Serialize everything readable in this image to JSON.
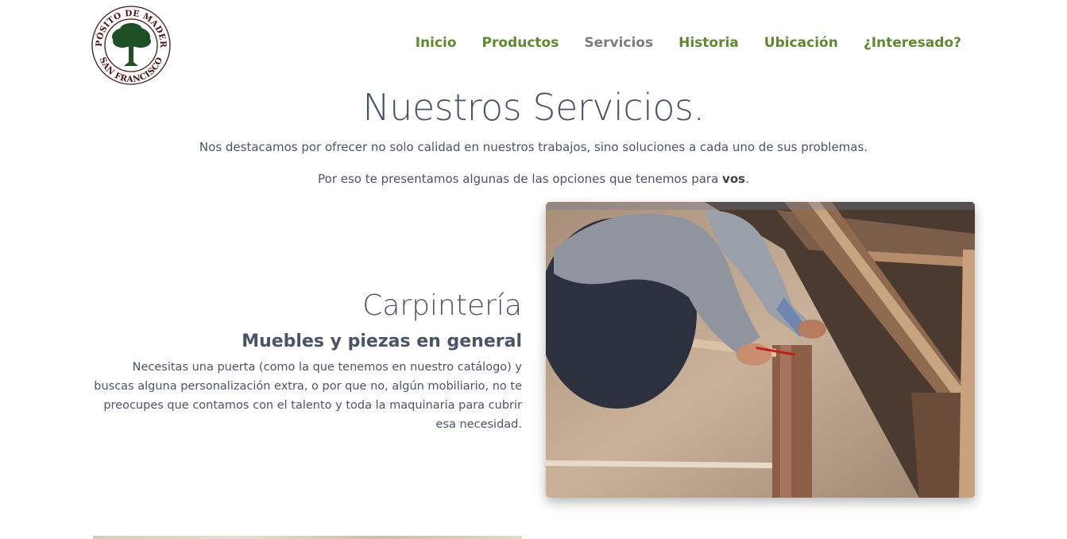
{
  "brand": {
    "logo_text_top": "DEPÓSITO DE MADERAS",
    "logo_text_bottom": "SAN FRANCISCO",
    "colors": {
      "accent_green": "#5d8a2e",
      "active_gray": "#7c7c7c",
      "text": "#4a5468",
      "logo_tree": "#1f4f25",
      "logo_text": "#4a1414"
    }
  },
  "nav": {
    "items": [
      {
        "label": "Inicio"
      },
      {
        "label": "Productos"
      },
      {
        "label": "Servicios",
        "active": true
      },
      {
        "label": "Historia"
      },
      {
        "label": "Ubicación"
      },
      {
        "label": "¿Interesado?"
      }
    ]
  },
  "hero": {
    "title": "Nuestros Servicios.",
    "line1": "Nos destacamos por ofrecer no solo calidad en nuestros trabajos, sino soluciones a cada uno de sus problemas.",
    "line2_prefix": "Por eso te presentamos algunas de las opciones que tenemos para ",
    "line2_bold": "vos",
    "line2_suffix": "."
  },
  "service": {
    "title": "Carpintería",
    "subtitle": "Muebles y piezas en general",
    "description": "Necesitas una puerta (como la que tenemos en nuestro catálogo) y buscas alguna personalización extra, o por que no, algún mobiliario, no te preocupes que contamos con el talento y toda la maquinaria para cubrir esa necesidad.",
    "image": "carpenter measuring wooden boards"
  }
}
